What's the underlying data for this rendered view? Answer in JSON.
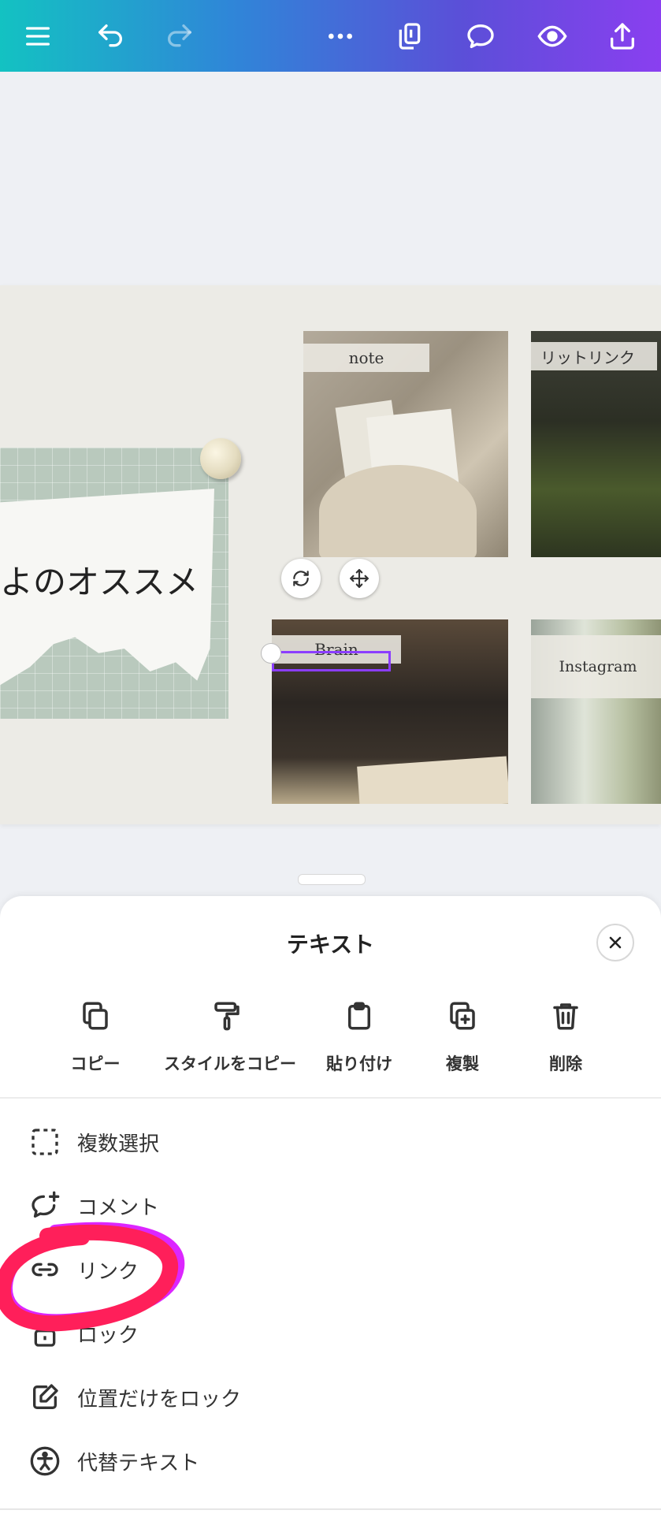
{
  "toolbar": {
    "icons": [
      "menu-icon",
      "undo-icon",
      "redo-icon",
      "more-icon",
      "pages-icon",
      "comment-icon",
      "preview-icon",
      "share-icon"
    ]
  },
  "canvas": {
    "title_fragment": "よのオススメ",
    "labels": {
      "note": "note",
      "lit_link": "リットリンク",
      "brain": "Brain",
      "instagram": "Instagram"
    }
  },
  "sheet": {
    "title": "テキスト",
    "actions": [
      {
        "label": "コピー",
        "icon": "copy-icon"
      },
      {
        "label": "スタイルをコピー",
        "icon": "paint-roller-icon"
      },
      {
        "label": "貼り付け",
        "icon": "clipboard-icon"
      },
      {
        "label": "複製",
        "icon": "duplicate-icon"
      },
      {
        "label": "削除",
        "icon": "trash-icon"
      }
    ],
    "menu": [
      {
        "label": "複数選択",
        "icon": "dashed-select-icon"
      },
      {
        "label": "コメント",
        "icon": "add-comment-icon"
      },
      {
        "label": "リンク",
        "icon": "link-icon"
      },
      {
        "label": "ロック",
        "icon": "lock-icon"
      },
      {
        "label": "位置だけをロック",
        "icon": "lock-position-icon"
      },
      {
        "label": "代替テキスト",
        "icon": "accessibility-icon"
      }
    ]
  },
  "colors": {
    "accent": "#8b3dff",
    "annotation": "#ff1f5a",
    "annotation_secondary": "#d600ff"
  }
}
